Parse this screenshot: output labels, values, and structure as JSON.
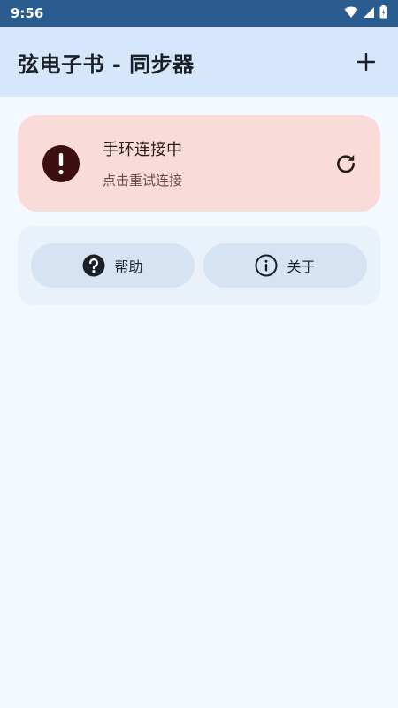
{
  "status_bar": {
    "time": "9:56",
    "icons": [
      "wifi-icon",
      "signal-icon",
      "battery-icon"
    ]
  },
  "app_bar": {
    "title": "弦电子书 - 同步器",
    "add_icon": "plus-icon"
  },
  "connection_card": {
    "title": "手环连接中",
    "subtitle": "点击重试连接",
    "status_icon": "error-icon",
    "action_icon": "refresh-icon"
  },
  "actions": [
    {
      "label": "帮助",
      "icon": "help-icon"
    },
    {
      "label": "关于",
      "icon": "info-icon"
    }
  ],
  "colors": {
    "status_bar": "#2b5c8f",
    "app_bar": "#d6e7fb",
    "background": "#f4f9ff",
    "error_card": "#f9dcda",
    "error_icon": "#3d0f0f",
    "actions_card": "#e9f1fb",
    "pill": "#d5e3f3"
  }
}
